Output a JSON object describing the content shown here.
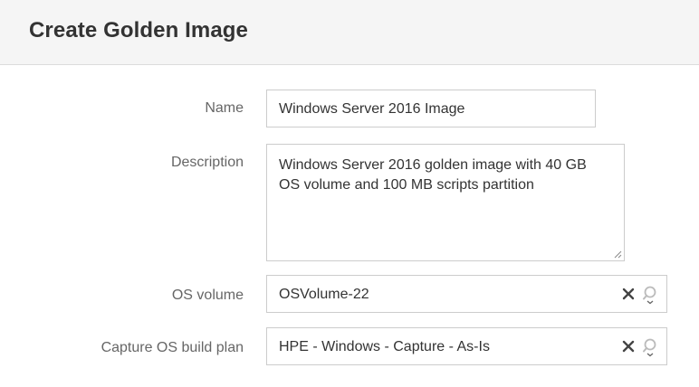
{
  "header": {
    "title": "Create Golden Image"
  },
  "form": {
    "name": {
      "label": "Name",
      "value": "Windows Server 2016 Image"
    },
    "description": {
      "label": "Description",
      "value": "Windows Server 2016 golden image with 40 GB OS volume and 100 MB scripts partition"
    },
    "os_volume": {
      "label": "OS volume",
      "value": "OSVolume-22",
      "icons": [
        "clear-icon",
        "search-icon"
      ]
    },
    "build_plan": {
      "label": "Capture OS build plan",
      "value": "HPE - Windows - Capture - As-Is",
      "icons": [
        "clear-icon",
        "search-icon"
      ]
    }
  },
  "colors": {
    "header_bg": "#f5f5f5",
    "label_text": "#666666",
    "field_border": "#cccccc",
    "icon": "#555555"
  }
}
